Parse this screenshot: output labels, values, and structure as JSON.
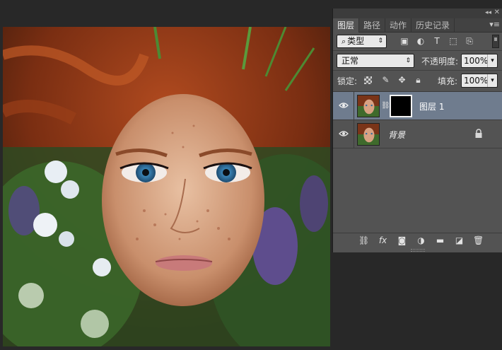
{
  "panel": {
    "tabs": [
      {
        "label": "图层",
        "active": true
      },
      {
        "label": "路径",
        "active": false
      },
      {
        "label": "动作",
        "active": false
      },
      {
        "label": "历史记录",
        "active": false
      }
    ],
    "filter": {
      "label": "类型"
    },
    "blend_mode": "正常",
    "opacity_label": "不透明度:",
    "opacity_value": "100%",
    "lock_label": "锁定:",
    "fill_label": "填充:",
    "fill_value": "100%",
    "layers": [
      {
        "name": "图层 1",
        "selected": true,
        "has_mask": true
      },
      {
        "name": "背景",
        "selected": false,
        "locked": true
      }
    ]
  },
  "colors": {
    "panel_bg": "#535353",
    "selected_layer": "#6f7c8e",
    "workspace": "#282828"
  }
}
